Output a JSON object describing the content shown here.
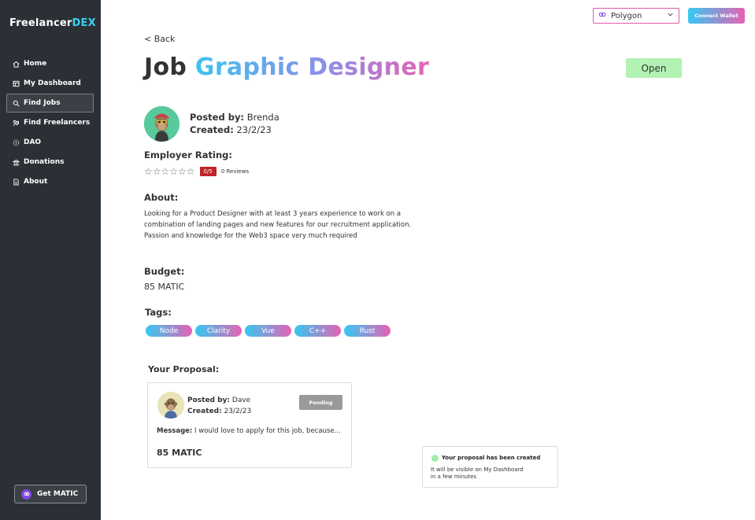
{
  "brand": {
    "name_part1": "Freelancer",
    "name_part2": "DEX"
  },
  "sidebar": {
    "items": [
      {
        "label": "Home",
        "icon": "home-icon"
      },
      {
        "label": "My Dashboard",
        "icon": "dashboard-icon"
      },
      {
        "label": "Find Jobs",
        "icon": "search-icon",
        "active": true
      },
      {
        "label": "Find Freelancers",
        "icon": "freelancers-icon"
      },
      {
        "label": "DAO",
        "icon": "dao-icon"
      },
      {
        "label": "Donations",
        "icon": "donations-icon"
      },
      {
        "label": "About",
        "icon": "about-icon"
      }
    ],
    "get_matic_label": "Get MATIC"
  },
  "topbar": {
    "network_selected": "Polygon",
    "connect_label": "Connect Wallet"
  },
  "job": {
    "back_label": "< Back",
    "title_prefix": "Job",
    "title_name": "Graphic Designer",
    "status": "Open",
    "posted_by_label": "Posted by:",
    "posted_by": "Brenda",
    "created_label": "Created:",
    "created": "23/2/23",
    "rating_label": "Employer Rating:",
    "rating_stars": "☆☆☆☆☆☆",
    "rating_score": "0/5",
    "rating_reviews": "0 Reviews",
    "about_label": "About:",
    "about_text": "Looking for a Product Designer with at least 3 years experience to work on a combination of landing pages and new features for our recruitment application. Passion and knowledge for the Web3 space very much required",
    "budget_label": "Budget:",
    "budget": "85 MATIC",
    "tags_label": "Tags:",
    "tags": [
      "Node",
      "Clarity",
      "Vue",
      "C++",
      "Rust"
    ]
  },
  "proposal": {
    "section_label": "Your Proposal:",
    "posted_by_label": "Posted by:",
    "posted_by": "Dave",
    "created_label": "Created:",
    "created": "23/2/23",
    "status": "Pending",
    "message_label": "Message:",
    "message": "I would love to apply for this job, because...",
    "amount": "85 MATIC"
  },
  "toast": {
    "title": "Your proposal has been created",
    "line1": "It will be visible on My Dashboard",
    "line2": "in a few minutes"
  },
  "colors": {
    "sidebar_bg": "#2b3036",
    "brand_accent": "#36d1f0",
    "gradient_start": "#36c8f2",
    "gradient_end": "#e562b3",
    "open_badge": "#b2f2b2",
    "score_badge": "#c0242a",
    "pending_badge": "#9a9a9a"
  }
}
